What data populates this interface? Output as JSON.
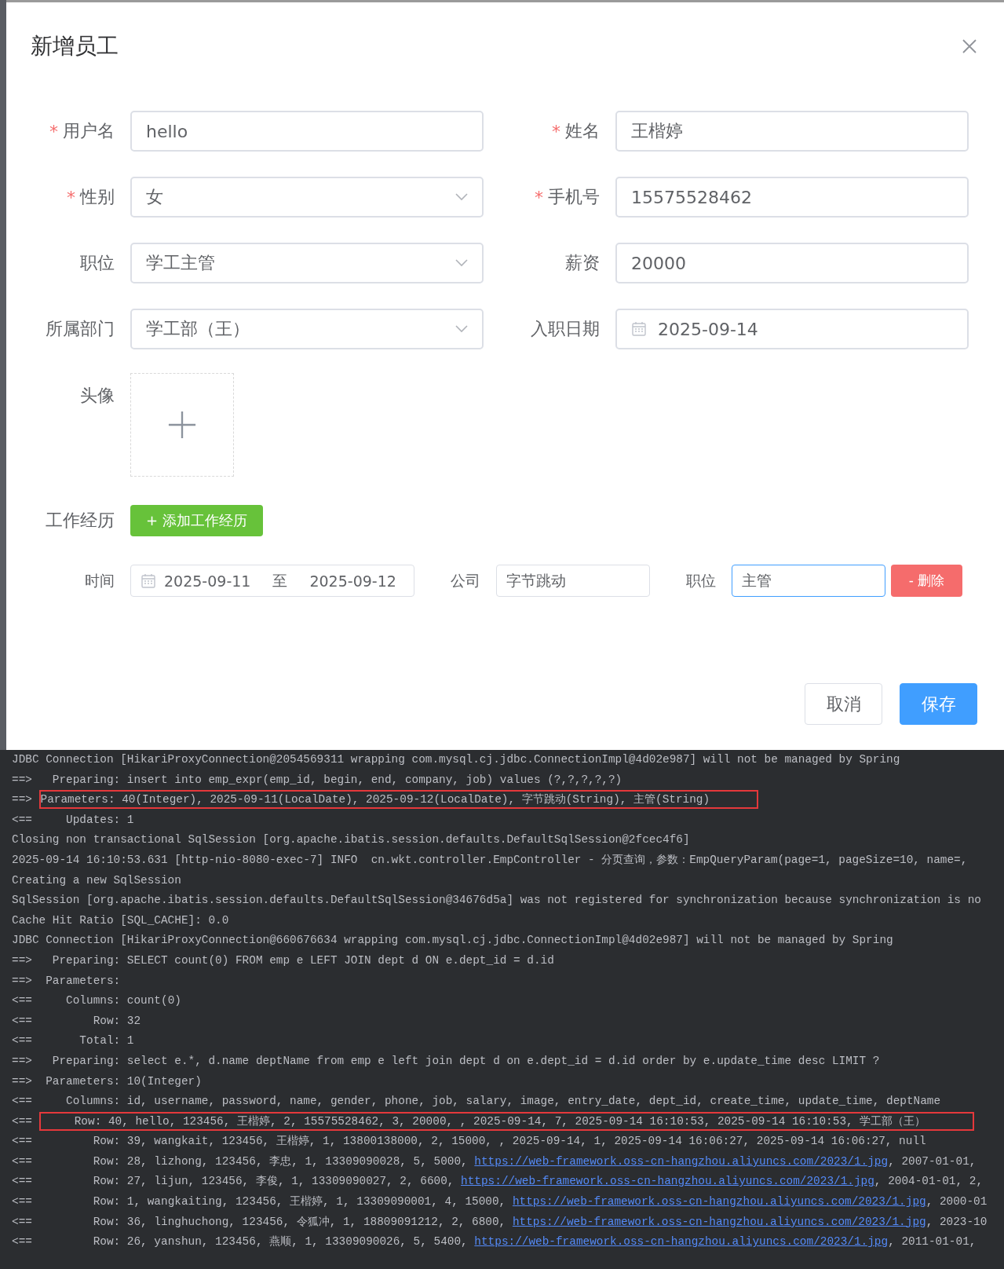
{
  "dialog": {
    "title": "新增员工",
    "fields": [
      {
        "label": "用户名",
        "required_mark": "*",
        "kind": "text",
        "value": "hello"
      },
      {
        "label": "姓名",
        "required_mark": "*",
        "kind": "text",
        "value": "王楷婷"
      },
      {
        "label": "性别",
        "required_mark": "*",
        "kind": "select",
        "value": "女"
      },
      {
        "label": "手机号",
        "required_mark": "*",
        "kind": "text",
        "value": "15575528462"
      },
      {
        "label": "职位",
        "kind": "select",
        "value": "学工主管"
      },
      {
        "label": "薪资",
        "kind": "text",
        "value": "20000"
      },
      {
        "label": "所属部门",
        "kind": "select",
        "value": "学工部（王）"
      },
      {
        "label": "入职日期",
        "kind": "date",
        "value": "2025-09-14"
      }
    ],
    "avatar": {
      "label": "头像"
    },
    "experience": {
      "label": "工作经历",
      "add_button": "+ 添加工作经历",
      "entries": [
        {
          "time_label": "时间",
          "start": "2025-09-11",
          "separator": "至",
          "end": "2025-09-12",
          "company_label": "公司",
          "company": "字节跳动",
          "job_label": "职位",
          "job": "主管",
          "job_focused": true,
          "delete_button": "- 删除"
        }
      ]
    },
    "buttons": [
      {
        "label": "取消",
        "kind": "default"
      },
      {
        "label": "保存",
        "kind": "primary"
      }
    ]
  },
  "console": {
    "lines": [
      {
        "segments": [
          {
            "kind": "text",
            "text": "JDBC Connection [HikariProxyConnection@2054569311 wrapping com.mysql.cj.jdbc.ConnectionImpl@4d02e987] will not be managed by Spring"
          }
        ]
      },
      {
        "prefix": "==>",
        "segments": [
          {
            "kind": "text",
            "text": "  Preparing: insert into emp_expr(emp_id, begin, end, company, job) values (?,?,?,?,?)"
          }
        ]
      },
      {
        "prefix": "==>",
        "highlighted": true,
        "segments": [
          {
            "kind": "text",
            "text": "Parameters: 40(Integer), 2025-09-11(LocalDate), 2025-09-12(LocalDate), 字节跳动(String), 主管(String)"
          }
        ]
      },
      {
        "prefix": "<==",
        "segments": [
          {
            "kind": "text",
            "text": "    Updates: 1"
          }
        ]
      },
      {
        "segments": [
          {
            "kind": "text",
            "text": "Closing non transactional SqlSession [org.apache.ibatis.session.defaults.DefaultSqlSession@2fcec4f6]"
          }
        ]
      },
      {
        "segments": [
          {
            "kind": "text",
            "text": "2025-09-14 16:10:53.631 [http-nio-8080-exec-7] INFO  cn.wkt.controller.EmpController - 分页查询，参数：EmpQueryParam(page=1, pageSize=10, name=,"
          }
        ]
      },
      {
        "segments": [
          {
            "kind": "text",
            "text": "Creating a new SqlSession"
          }
        ]
      },
      {
        "segments": [
          {
            "kind": "text",
            "text": "SqlSession [org.apache.ibatis.session.defaults.DefaultSqlSession@34676d5a] was not registered for synchronization because synchronization is no"
          }
        ]
      },
      {
        "segments": [
          {
            "kind": "text",
            "text": "Cache Hit Ratio [SQL_CACHE]: 0.0"
          }
        ]
      },
      {
        "segments": [
          {
            "kind": "text",
            "text": "JDBC Connection [HikariProxyConnection@660676634 wrapping com.mysql.cj.jdbc.ConnectionImpl@4d02e987] will not be managed by Spring"
          }
        ]
      },
      {
        "prefix": "==>",
        "segments": [
          {
            "kind": "text",
            "text": "  Preparing: SELECT count(0) FROM emp e LEFT JOIN dept d ON e.dept_id = d.id"
          }
        ]
      },
      {
        "prefix": "==>",
        "segments": [
          {
            "kind": "text",
            "text": " Parameters:"
          }
        ]
      },
      {
        "prefix": "<==",
        "segments": [
          {
            "kind": "text",
            "text": "    Columns: count(0)"
          }
        ]
      },
      {
        "prefix": "<==",
        "segments": [
          {
            "kind": "text",
            "text": "        Row: 32"
          }
        ]
      },
      {
        "prefix": "<==",
        "segments": [
          {
            "kind": "text",
            "text": "      Total: 1"
          }
        ]
      },
      {
        "prefix": "==>",
        "segments": [
          {
            "kind": "text",
            "text": "  Preparing: select e.*, d.name deptName from emp e left join dept d on e.dept_id = d.id order by e.update_time desc LIMIT ?"
          }
        ]
      },
      {
        "prefix": "==>",
        "segments": [
          {
            "kind": "text",
            "text": " Parameters: 10(Integer)"
          }
        ]
      },
      {
        "prefix": "<==",
        "segments": [
          {
            "kind": "text",
            "text": "    Columns: id, username, password, name, gender, phone, job, salary, image, entry_date, dept_id, create_time, update_time, deptName"
          }
        ]
      },
      {
        "prefix": "<==",
        "highlighted": true,
        "segments": [
          {
            "kind": "text",
            "text": "     Row: 40, hello, 123456, 王楷婷, 2, 15575528462, 3, 20000, , 2025-09-14, 7, 2025-09-14 16:10:53, 2025-09-14 16:10:53, 学工部（王）"
          }
        ]
      },
      {
        "prefix": "<==",
        "segments": [
          {
            "kind": "text",
            "text": "        Row: 39, wangkait, 123456, 王楷婷, 1, 13800138000, 2, 15000, , 2025-09-14, 1, 2025-09-14 16:06:27, 2025-09-14 16:06:27, null"
          }
        ]
      },
      {
        "prefix": "<==",
        "segments": [
          {
            "kind": "text",
            "text": "        Row: 28, lizhong, 123456, 李忠, 1, 13309090028, 5, 5000, "
          },
          {
            "kind": "link",
            "text": "https://web-framework.oss-cn-hangzhou.aliyuncs.com/2023/1.jpg"
          },
          {
            "kind": "text",
            "text": ", 2007-01-01,"
          }
        ]
      },
      {
        "prefix": "<==",
        "segments": [
          {
            "kind": "text",
            "text": "        Row: 27, lijun, 123456, 李俊, 1, 13309090027, 2, 6600, "
          },
          {
            "kind": "link",
            "text": "https://web-framework.oss-cn-hangzhou.aliyuncs.com/2023/1.jpg"
          },
          {
            "kind": "text",
            "text": ", 2004-01-01, 2,"
          }
        ]
      },
      {
        "prefix": "<==",
        "segments": [
          {
            "kind": "text",
            "text": "        Row: 1, wangkaiting, 123456, 王楷婷, 1, 13309090001, 4, 15000, "
          },
          {
            "kind": "link",
            "text": "https://web-framework.oss-cn-hangzhou.aliyuncs.com/2023/1.jpg"
          },
          {
            "kind": "text",
            "text": ", 2000-01"
          }
        ]
      },
      {
        "prefix": "<==",
        "segments": [
          {
            "kind": "text",
            "text": "        Row: 36, linghuchong, 123456, 令狐冲, 1, 18809091212, 2, 6800, "
          },
          {
            "kind": "link",
            "text": "https://web-framework.oss-cn-hangzhou.aliyuncs.com/2023/1.jpg"
          },
          {
            "kind": "text",
            "text": ", 2023-10"
          }
        ]
      },
      {
        "prefix": "<==",
        "segments": [
          {
            "kind": "text",
            "text": "        Row: 26, yanshun, 123456, 燕顺, 1, 13309090026, 5, 5400, "
          },
          {
            "kind": "link",
            "text": "https://web-framework.oss-cn-hangzhou.aliyuncs.com/2023/1.jpg"
          },
          {
            "kind": "text",
            "text": ", 2011-01-01,"
          }
        ]
      }
    ]
  }
}
